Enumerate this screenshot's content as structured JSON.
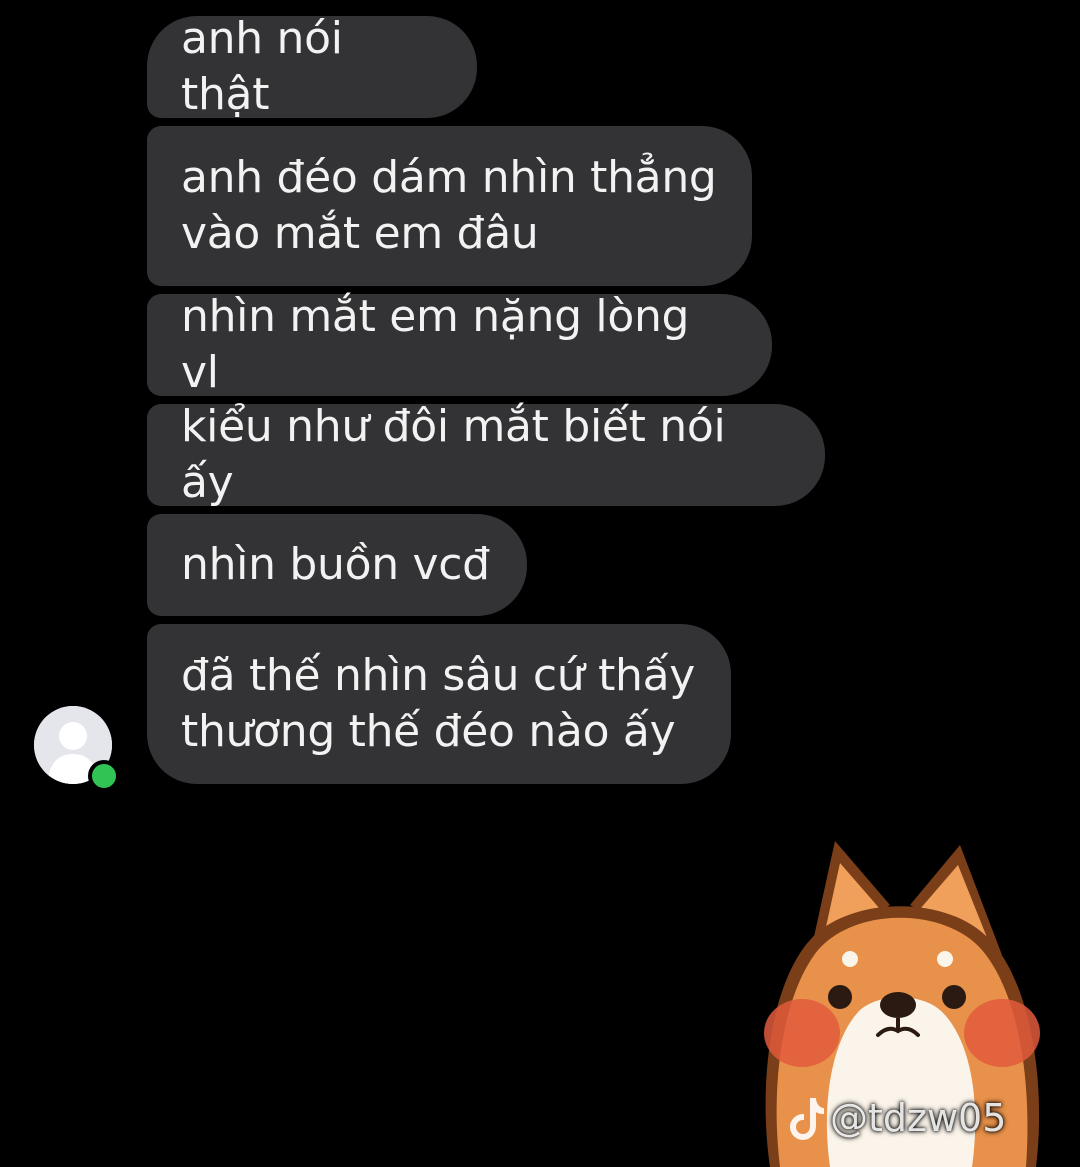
{
  "messages": [
    {
      "text": "anh nói thật"
    },
    {
      "text": "anh đéo dám nhìn thẳng\nvào mắt em đâu"
    },
    {
      "text": "nhìn mắt em nặng lòng vl"
    },
    {
      "text": "kiểu như đôi mắt biết nói ấy"
    },
    {
      "text": "nhìn buồn vcđ"
    },
    {
      "text": "đã thế nhìn sâu cứ thấy\nthương thế đéo nào ấy"
    }
  ],
  "sender": {
    "avatar_icon": "default-user-silhouette-icon",
    "presence": "online",
    "presence_color": "#31c454"
  },
  "sticker": {
    "icon": "shiba-dog-sticker"
  },
  "watermark": {
    "icon": "tiktok-logo-icon",
    "text": "@tdzw05"
  },
  "colors": {
    "background": "#000000",
    "bubble": "#333335",
    "bubble_text": "#f2f2f2"
  }
}
